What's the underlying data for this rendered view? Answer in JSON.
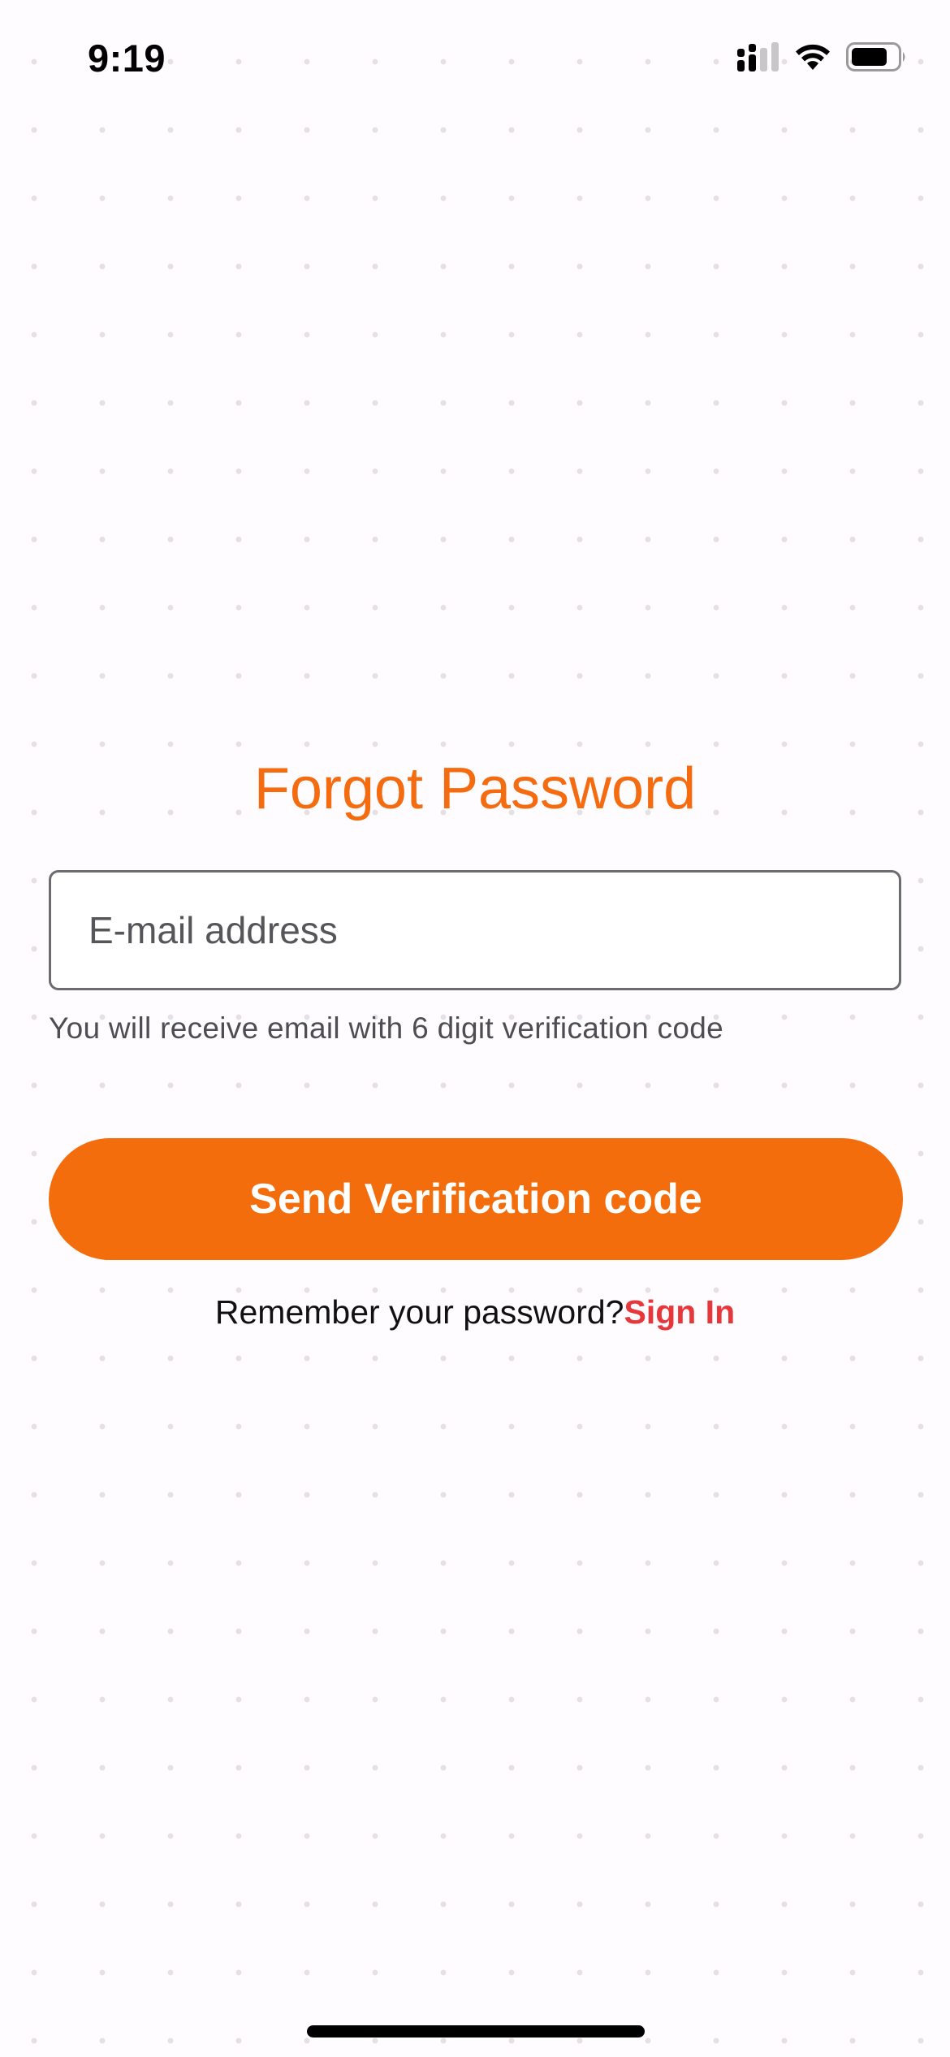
{
  "status_bar": {
    "time": "9:19",
    "icons": [
      "cellular-signal-icon",
      "wifi-icon",
      "battery-icon"
    ]
  },
  "screen": {
    "title": "Forgot Password",
    "email_placeholder": "E-mail address",
    "email_value": "",
    "helper_text": "You will receive email with 6 digit verification code",
    "send_button_label": "Send Verification code",
    "remember_text": "Remember your password?",
    "signin_link_label": "Sign In"
  },
  "colors": {
    "accent": "#f46d0c",
    "title": "#f46b10",
    "link": "#e8373a",
    "background": "#fefcfe"
  }
}
